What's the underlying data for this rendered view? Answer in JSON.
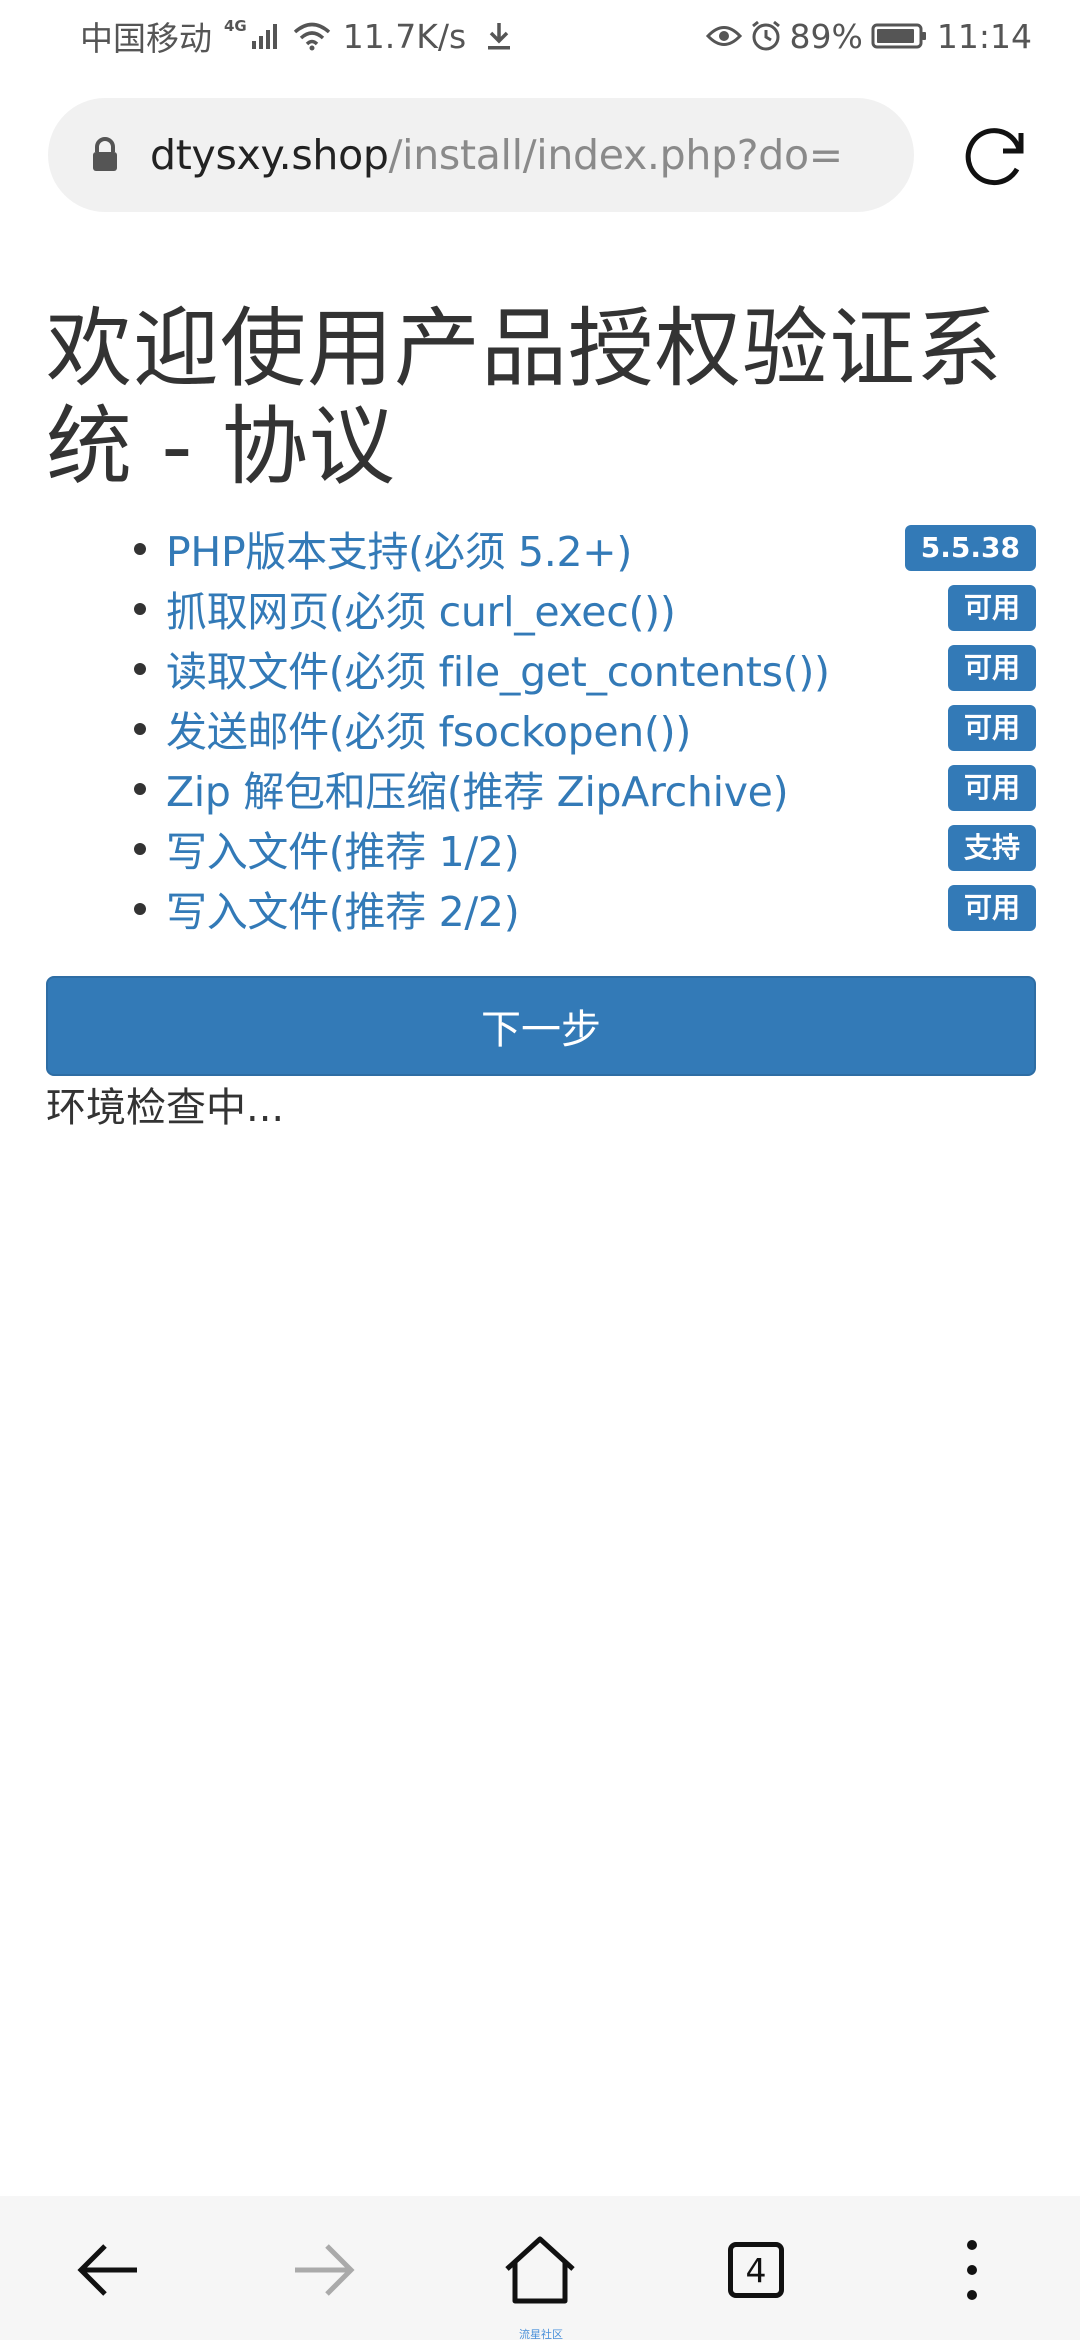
{
  "status_bar": {
    "carrier": "中国移动",
    "network_type": "4G",
    "speed": "11.7K/s",
    "battery": "89%",
    "time": "11:14"
  },
  "address_bar": {
    "domain": "dtysxy.shop",
    "path": "/install/index.php?do="
  },
  "page": {
    "title": "欢迎使用产品授权验证系统 - 协议",
    "checks": [
      {
        "label": "PHP版本支持(必须 5.2+)",
        "badge": "5.5.38"
      },
      {
        "label": "抓取网页(必须 curl_exec())",
        "badge": "可用"
      },
      {
        "label": "读取文件(必须 file_get_contents())",
        "badge": "可用"
      },
      {
        "label": "发送邮件(必须 fsockopen())",
        "badge": "可用"
      },
      {
        "label": "Zip 解包和压缩(推荐 ZipArchive)",
        "badge": "可用"
      },
      {
        "label": "写入文件(推荐 1/2)",
        "badge": "支持"
      },
      {
        "label": "写入文件(推荐 2/2)",
        "badge": "可用"
      }
    ],
    "next_button": "下一步",
    "env_status": "环境检查中..."
  },
  "bottom_nav": {
    "tab_count": "4",
    "watermark": "流星社区"
  },
  "colors": {
    "accent": "#337ab7",
    "text": "#333333",
    "url_bar_bg": "#f1f1f1",
    "nav_bg": "#f6f6f6"
  },
  "icons": [
    "signal-icon",
    "wifi-icon",
    "download-icon",
    "eye-icon",
    "alarm-icon",
    "battery-icon",
    "lock-icon",
    "reload-icon",
    "back-arrow-icon",
    "forward-arrow-icon",
    "home-icon",
    "tabs-icon",
    "more-icon"
  ]
}
